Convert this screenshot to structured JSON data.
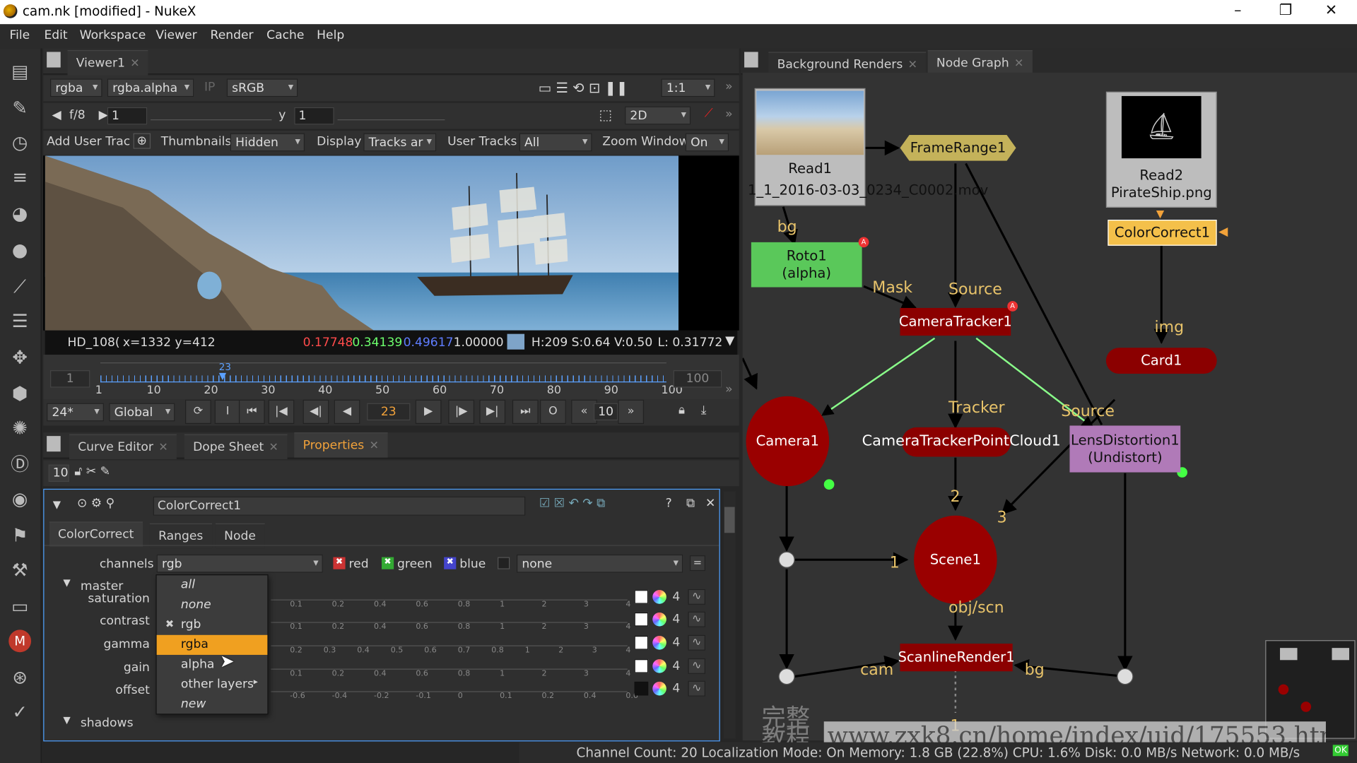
{
  "window": {
    "title": "cam.nk [modified] - NukeX",
    "minimize": "–",
    "maximize": "❐",
    "close": "✕"
  },
  "menubar": [
    "File",
    "Edit",
    "Workspace",
    "Viewer",
    "Render",
    "Cache",
    "Help"
  ],
  "viewer": {
    "tab": "Viewer1",
    "channels": "rgba",
    "channel_alpha": "rgba.alpha",
    "ip": "IP",
    "colorspace": "sRGB",
    "frame_step": "f/8",
    "gain": "1",
    "y_label": "y",
    "gamma": "1",
    "ratio": "1:1",
    "mode": "2D",
    "add_user_track": "Add User Trac",
    "thumbnails_label": "Thumbnails",
    "thumbnails_value": "Hidden",
    "display_label": "Display",
    "display_value": "Tracks ar",
    "user_tracks_label": "User Tracks",
    "user_tracks_value": "All",
    "zoom_label": "Zoom Window",
    "zoom_value": "On",
    "info": {
      "format": "HD_108(",
      "coords": "x=1332 y=412",
      "r": "0.17748",
      "g": "0.34139",
      "b": "0.49617",
      "a": "1.00000",
      "hsv": "H:209 S:0.64 V:0.50",
      "lum": "L: 0.31772"
    },
    "timeline": {
      "start": "1",
      "end": "100",
      "current": "23",
      "ticks": [
        "1",
        "10",
        "20",
        "30",
        "40",
        "50",
        "60",
        "70",
        "80",
        "90",
        "100"
      ],
      "current_marker": "23"
    },
    "playback": {
      "fps": "24*",
      "scope": "Global",
      "frame": "23",
      "step": "10"
    }
  },
  "bottom_tabs": [
    "Curve Editor",
    "Dope Sheet",
    "Properties"
  ],
  "properties": {
    "max_panels": "10",
    "node_name": "ColorCorrect1",
    "tabs": [
      "ColorCorrect",
      "Ranges",
      "Node"
    ],
    "channels_label": "channels",
    "channels_value": "rgb",
    "red": "red",
    "green": "green",
    "blue": "blue",
    "extra_channel": "none",
    "master": "master",
    "shadows": "shadows",
    "knobs": [
      {
        "label": "saturation",
        "value": "4",
        "ticks": [
          "0.1",
          "0.2",
          "0.4",
          "0.6",
          "0.8",
          "1",
          "2",
          "3",
          "4"
        ],
        "swatch": "#ffffff"
      },
      {
        "label": "contrast",
        "value": "4",
        "ticks": [
          "0.1",
          "0.2",
          "0.4",
          "0.6",
          "0.8",
          "1",
          "2",
          "3",
          "4"
        ],
        "swatch": "#ffffff"
      },
      {
        "label": "gamma",
        "value": "4",
        "ticks": [
          "0.2",
          "0.3",
          "0.4",
          "0.5",
          "0.6",
          "0.7",
          "0.8",
          "1",
          "2",
          "3",
          "4"
        ],
        "swatch": "#ffffff"
      },
      {
        "label": "gain",
        "value": "4",
        "ticks": [
          "0.1",
          "0.2",
          "0.4",
          "0.6",
          "0.8",
          "1",
          "2",
          "3",
          "4"
        ],
        "swatch": "#ffffff"
      },
      {
        "label": "offset",
        "value": "4",
        "ticks": [
          "-0.6",
          "-0.4",
          "-0.2",
          "-0.1",
          "0",
          "0.1",
          "0.2",
          "0.4",
          "0.6"
        ],
        "swatch": "#111111"
      }
    ],
    "dropdown": [
      "all",
      "none",
      "rgb",
      "rgba",
      "alpha",
      "other layers",
      "new"
    ],
    "dropdown_selected": "rgba"
  },
  "nodegraph": {
    "tabs": [
      "Background Renders",
      "Node Graph"
    ],
    "nodes": {
      "read1": "Read1",
      "read1_file": "1_1_2016-03-03_0234_C0002.mov",
      "read2": "Read2",
      "read2_file": "PirateShip.png",
      "framerange": "FrameRange1",
      "colorcorrect": "ColorCorrect1",
      "roto": "Roto1",
      "roto_sub": "(alpha)",
      "cameratracker": "CameraTracker1",
      "card": "Card1",
      "camera": "Camera1",
      "pointcloud": "CameraTrackerPointCloud1",
      "lensdist": "LensDistortion1",
      "lensdist_sub": "(Undistort)",
      "scene": "Scene1",
      "scanline": "ScanlineRender1"
    },
    "labels": {
      "bg": "bg",
      "mask": "Mask",
      "source": "Source",
      "img": "img",
      "tracker": "Tracker",
      "source2": "Source",
      "n2": "2",
      "n3": "3",
      "n1": "1",
      "objscn": "obj/scn",
      "cam": "cam",
      "bg2": "bg",
      "n1b": "1"
    }
  },
  "status": "Channel Count: 20 Localization Mode: On Memory: 1.8 GB (22.8%) CPU: 1.6% Disk: 0.0 MB/s Network: 0.0 MB/s",
  "status_ok": "OK",
  "watermark": "www.zxk8.cn/home/index/uid/175553.html",
  "watermark_cn": "完整教程"
}
